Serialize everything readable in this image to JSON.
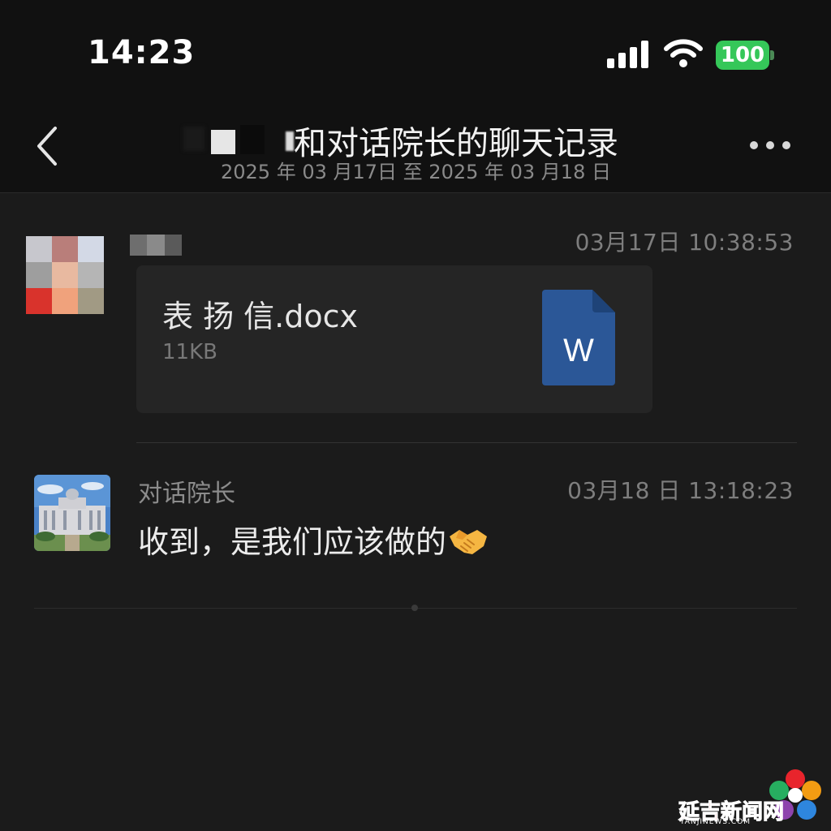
{
  "status_bar": {
    "time": "14:23",
    "battery": "100",
    "signal_icon": "cellular-signal-icon",
    "wifi_icon": "wifi-icon"
  },
  "header": {
    "back_icon": "chevron-left-icon",
    "title": "和对话院长的聊天记录",
    "subtitle": "2025 年 03 月17日 至 2025 年 03 月18 日",
    "more_icon": "more-horizontal-icon"
  },
  "messages": [
    {
      "sender": "",
      "timestamp": "03月17日 10:38:53",
      "file": {
        "name": "表 扬 信.docx",
        "size": "11KB",
        "icon": "word-document-icon",
        "icon_letter": "W"
      }
    },
    {
      "sender": "对话院长",
      "timestamp": "03月18 日 13:18:23",
      "text": "收到，是我们应该做的",
      "emoji_icon": "handshake-icon"
    }
  ],
  "watermark": {
    "text": "延吉新闻网",
    "sub": "YANJINEWS.COM"
  },
  "colors": {
    "background": "#1b1b1b",
    "header_bg": "#111111",
    "battery_green": "#35c759",
    "word_blue": "#2b5797",
    "watermark_red": "#e0141c"
  }
}
